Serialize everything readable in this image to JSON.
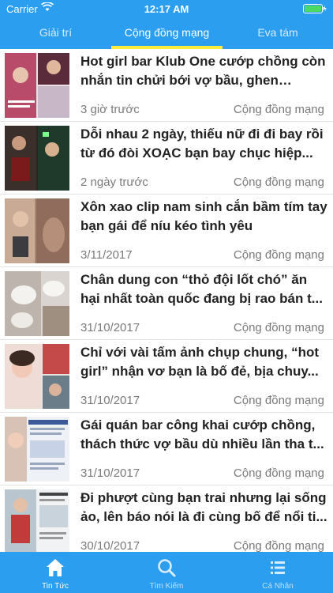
{
  "status": {
    "carrier": "Carrier",
    "time": "12:17 AM"
  },
  "tabs": [
    {
      "label": "Giải trí"
    },
    {
      "label": "Cộng đồng mạng",
      "active": true
    },
    {
      "label": "Eva tám"
    }
  ],
  "articles": [
    {
      "title": "Hot girl bar Klub One cướp chồng còn nhắn tin chửi bới vợ bầu, ghen ngược...",
      "date": "3 giờ trước",
      "category": "Cộng đồng mạng"
    },
    {
      "title": "Dỗi nhau 2 ngày, thiếu nữ đi đi bay rồi từ đó đòi XOẠC bạn bay chục hiệp...",
      "date": "2 ngày trước",
      "category": "Cộng đồng mạng"
    },
    {
      "title": "Xôn xao clip nam sinh cắn bầm tím tay bạn gái để níu kéo tình yêu",
      "date": "3/11/2017",
      "category": "Cộng đồng mạng"
    },
    {
      "title": "Chân dung con “thỏ đội lốt chó” ăn hại nhất toàn quốc đang bị rao bán t...",
      "date": "31/10/2017",
      "category": "Cộng đồng mạng"
    },
    {
      "title": "Chỉ với vài tấm ảnh chụp chung, “hot girl” nhận vơ bạn là bố đẻ, bịa chuy...",
      "date": "31/10/2017",
      "category": "Cộng đồng mạng"
    },
    {
      "title": "Gái quán bar công khai cướp chồng, thách thức vợ bầu dù nhiều lần tha t...",
      "date": "31/10/2017",
      "category": "Cộng đồng mạng"
    },
    {
      "title": "Đi phượt cùng bạn trai nhưng lại sống ảo, lên báo nói là đi cùng bố để nổi ti...",
      "date": "30/10/2017",
      "category": "Cộng đồng mạng"
    }
  ],
  "bottom_tabs": [
    {
      "label": "Tin Tức",
      "icon": "home-icon",
      "active": true
    },
    {
      "label": "Tìm Kiếm",
      "icon": "search-icon"
    },
    {
      "label": "Cá Nhân",
      "icon": "list-icon"
    }
  ],
  "colors": {
    "primary": "#2b9ef0",
    "tab_indicator": "#ffeb3b",
    "battery": "#4cd964"
  }
}
